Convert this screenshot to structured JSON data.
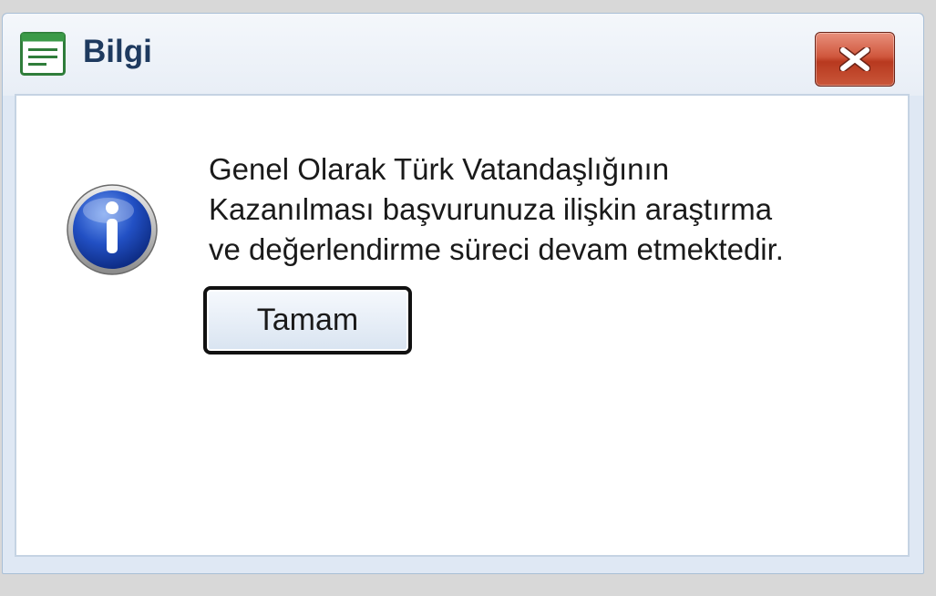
{
  "dialog": {
    "title": "Bilgi",
    "app_icon": "document-window-icon",
    "close_icon": "close-x-icon",
    "info_icon": "information-icon",
    "message_lines": [
      "Genel Olarak Türk Vatandaşlığının",
      "Kazanılması başvurunuza ilişkin araştırma",
      "ve değerlendirme süreci devam etmektedir."
    ],
    "ok_label": "Tamam"
  },
  "colors": {
    "title_text": "#1e3a5f",
    "close_button": "#c9573a",
    "info_blue": "#1f55c6",
    "background": "#d8d8d8"
  }
}
